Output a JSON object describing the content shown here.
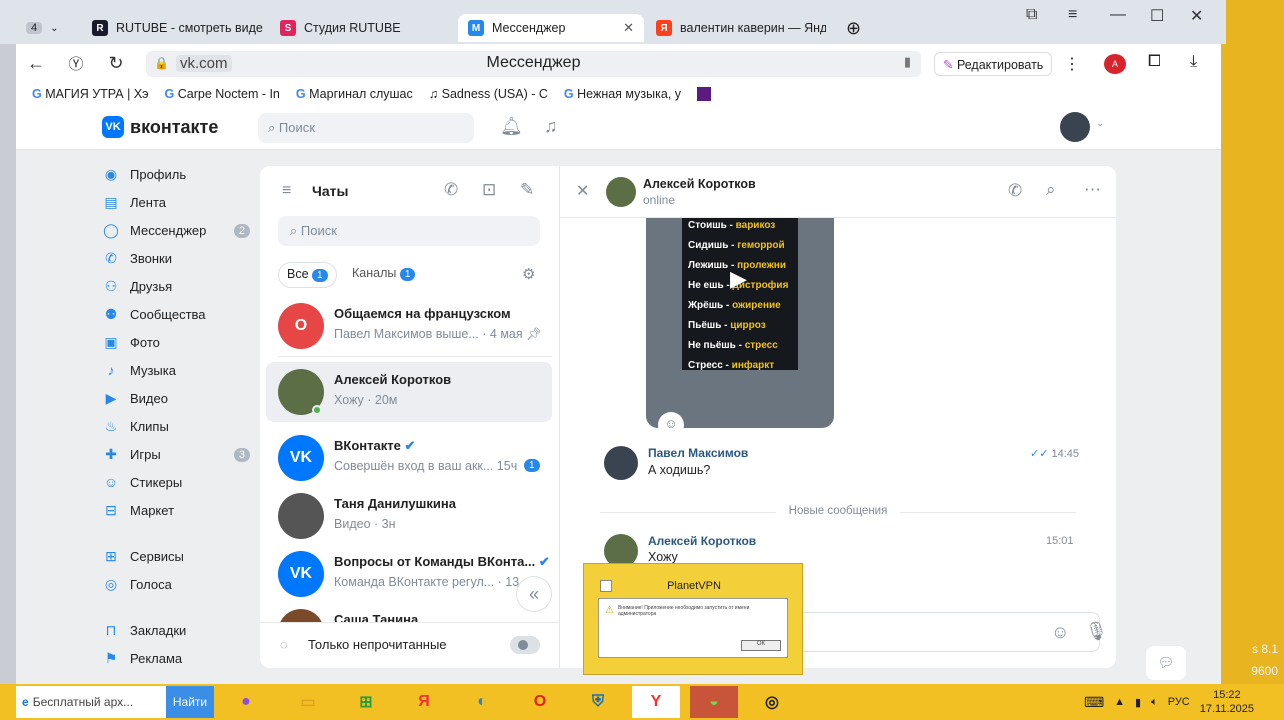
{
  "browser": {
    "tab_count": "4",
    "tabs": [
      {
        "label": "RUTUBE - смотреть виде",
        "icon": "R"
      },
      {
        "label": "Студия RUTUBE",
        "icon": "S"
      },
      {
        "label": "Мессенджер",
        "icon": "M"
      },
      {
        "label": "валентин каверин — Янд",
        "icon": "Я"
      }
    ],
    "domain": "vk.com",
    "page_title": "Мессенджер",
    "edit_label": "Редактировать",
    "bookmarks": [
      "МАГИЯ УТРА | Хэ",
      "Carpe Noctem - In",
      "Маргинал слушас",
      "Sadness (USA) - C",
      "Нежная музыка, у"
    ]
  },
  "vk": {
    "logo": "вконтакте",
    "search_placeholder": "Поиск",
    "menu": [
      {
        "label": "Профиль",
        "icon": "user-icon"
      },
      {
        "label": "Лента",
        "icon": "feed-icon"
      },
      {
        "label": "Мессенджер",
        "icon": "chat-icon",
        "count": "2"
      },
      {
        "label": "Звонки",
        "icon": "phone-icon"
      },
      {
        "label": "Друзья",
        "icon": "friends-icon"
      },
      {
        "label": "Сообщества",
        "icon": "groups-icon"
      },
      {
        "label": "Фото",
        "icon": "photo-icon"
      },
      {
        "label": "Музыка",
        "icon": "music-icon"
      },
      {
        "label": "Видео",
        "icon": "video-icon"
      },
      {
        "label": "Клипы",
        "icon": "clips-icon"
      },
      {
        "label": "Игры",
        "icon": "games-icon",
        "count": "3"
      },
      {
        "label": "Стикеры",
        "icon": "sticker-icon"
      },
      {
        "label": "Маркет",
        "icon": "market-icon"
      },
      {
        "label": "Сервисы",
        "icon": "services-icon"
      },
      {
        "label": "Голоса",
        "icon": "votes-icon"
      },
      {
        "label": "Закладки",
        "icon": "bookmark-icon"
      },
      {
        "label": "Реклама",
        "icon": "ads-icon"
      }
    ],
    "chats": {
      "title": "Чаты",
      "search_placeholder": "Поиск",
      "filter_all": "Все",
      "filter_all_count": "1",
      "filter_channels": "Каналы",
      "filter_channels_count": "1",
      "unread_only": "Только непрочитанные",
      "items": [
        {
          "name": "Общаемся на французском",
          "preview": "Павел Максимов выше...",
          "time": "4 мая",
          "avatar": "O",
          "color": "#e64646"
        },
        {
          "name": "Алексей Коротков",
          "preview": "Хожу",
          "time": "20м",
          "avatar": "",
          "color": "#5b6e45"
        },
        {
          "name": "ВКонтакте",
          "preview": "Совершён вход в ваш акк...",
          "time": "15ч",
          "avatar": "VK",
          "color": "#0077ff",
          "badge": "1"
        },
        {
          "name": "Таня Данилушкина",
          "preview": "Видео",
          "time": "3н",
          "avatar": "",
          "color": "#555"
        },
        {
          "name": "Вопросы от Команды ВКонта...",
          "preview": "Команда ВКонтакте регул...",
          "time": "13 ок",
          "avatar": "VK",
          "color": "#0077ff"
        },
        {
          "name": "Саша Танина",
          "preview": "",
          "time": "",
          "avatar": "",
          "color": "#7a4a2a"
        }
      ]
    },
    "conversation": {
      "contact": "Алексей Коротков",
      "status": "online",
      "video_lines": [
        {
          "a": "Стоишь - ",
          "b": "варикоз"
        },
        {
          "a": "Сидишь - ",
          "b": "геморрой"
        },
        {
          "a": "Лежишь - ",
          "b": "пролежни"
        },
        {
          "a": "Не ешь - ",
          "b": "дистрофия"
        },
        {
          "a": "Жрёшь - ",
          "b": "ожирение"
        },
        {
          "a": "Пьёшь - ",
          "b": "цирроз"
        },
        {
          "a": "Не пьёшь - ",
          "b": "стресс"
        },
        {
          "a": "Стресс - ",
          "b": "инфаркт"
        }
      ],
      "messages": [
        {
          "author": "Павел Максимов",
          "text": "А ходишь?",
          "time": "14:45"
        },
        {
          "author": "Алексей Коротков",
          "text": "Хожу",
          "time": "15:01"
        }
      ],
      "new_divider": "Новые сообщения"
    }
  },
  "popup": {
    "title": "PlanetVPN",
    "text": "Внимание! Приложение необходимо запустить от имени администратора",
    "ok": "ОК"
  },
  "taskbar": {
    "search": "Бесплатный арх...",
    "find": "Найти",
    "lang": "РУС",
    "time": "15:22",
    "date": "17.11.2025"
  },
  "desktop": {
    "w1": "s 8.1",
    "w2": "9600"
  }
}
